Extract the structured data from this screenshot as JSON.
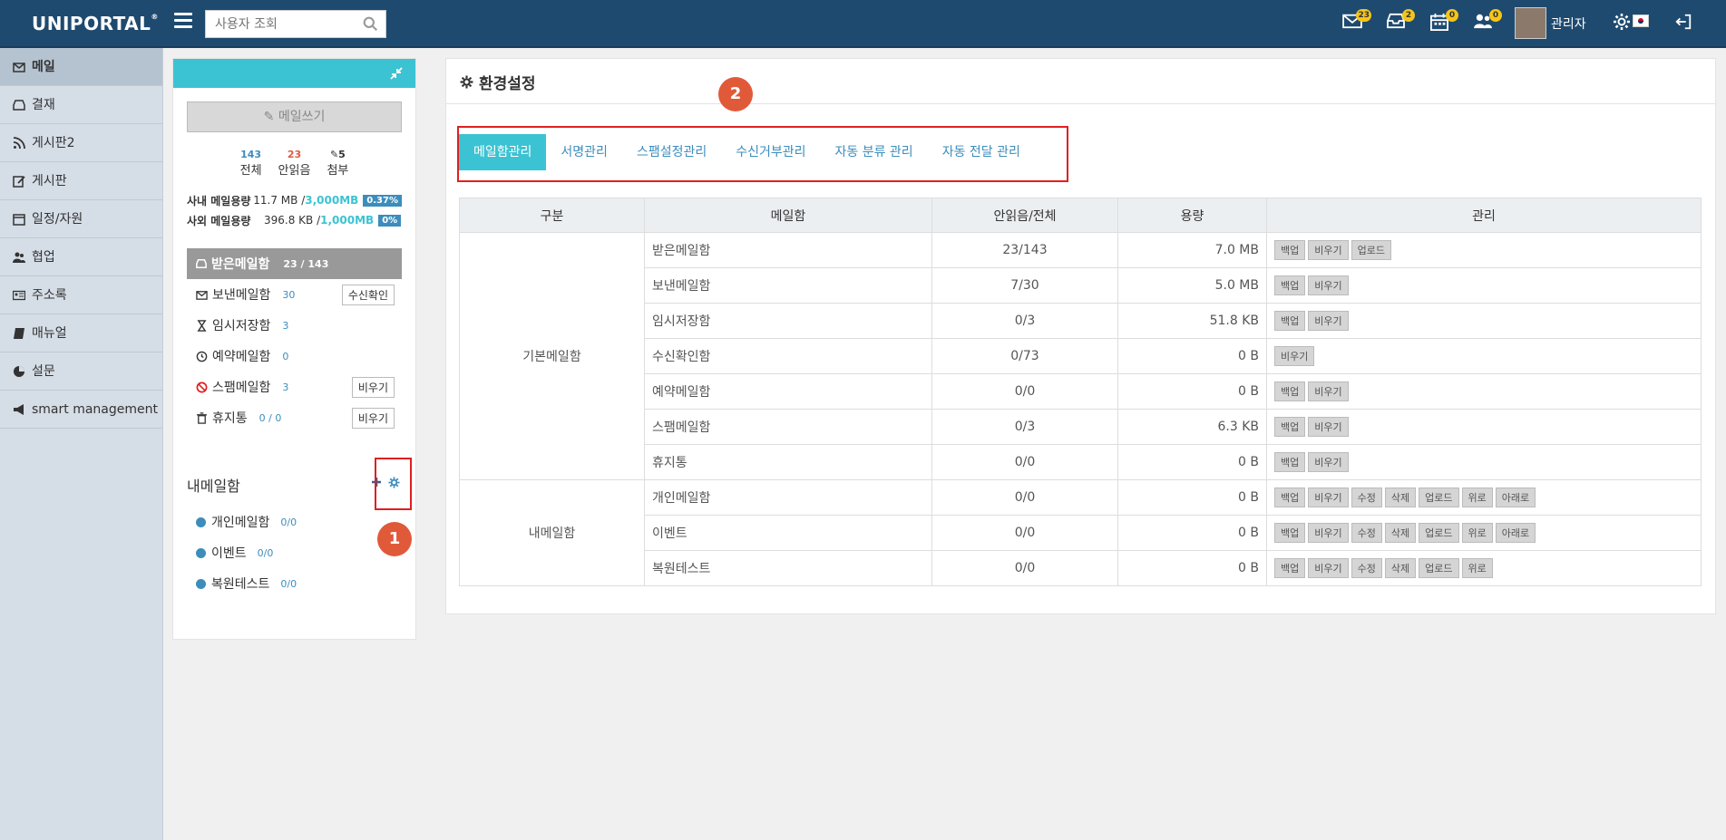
{
  "app": {
    "logo": "UNIPORTAL",
    "logo_mark": "®"
  },
  "header": {
    "search_placeholder": "사용자 조회",
    "badges": {
      "mail": "23",
      "inbox": "2",
      "calendar": "0",
      "people": "0"
    },
    "user_name": "관리자"
  },
  "leftnav": {
    "items": [
      {
        "label": "메일",
        "icon": "mail-icon"
      },
      {
        "label": "결재",
        "icon": "inbox-icon"
      },
      {
        "label": "게시판2",
        "icon": "rss-icon"
      },
      {
        "label": "게시판",
        "icon": "edit-icon"
      },
      {
        "label": "일정/자원",
        "icon": "calendar-icon"
      },
      {
        "label": "협업",
        "icon": "users-icon"
      },
      {
        "label": "주소록",
        "icon": "address-card-icon"
      },
      {
        "label": "매뉴얼",
        "icon": "book-icon"
      },
      {
        "label": "설문",
        "icon": "pie-chart-icon"
      },
      {
        "label": "smart management",
        "icon": "megaphone-icon"
      }
    ]
  },
  "mailpanel": {
    "write_label": "메일쓰기",
    "stats": [
      {
        "num": "143",
        "label": "전체"
      },
      {
        "num": "23",
        "label": "안읽음"
      },
      {
        "num": "5",
        "label": "첨부"
      }
    ],
    "quota": [
      {
        "label": "사내 메일용량",
        "used": "11.7 MB / ",
        "total": "3,000MB",
        "pct": "0.37%"
      },
      {
        "label": "사외 메일용량",
        "used": "396.8 KB / ",
        "total": "1,000MB",
        "pct": "0%"
      }
    ],
    "inbox": {
      "label": "받은메일함",
      "count": "23 / 143"
    },
    "folders": [
      {
        "label": "보낸메일함",
        "count": "30",
        "button": "수신확인"
      },
      {
        "label": "임시저장함",
        "count": "3",
        "button": ""
      },
      {
        "label": "예약메일함",
        "count": "0",
        "button": ""
      },
      {
        "label": "스팸메일함",
        "count": "3",
        "button": "비우기"
      },
      {
        "label": "휴지통",
        "count": "0 / 0",
        "button": "비우기"
      }
    ],
    "mybox_title": "내메일함",
    "mybox_items": [
      {
        "label": "개인메일함",
        "count": "0/0"
      },
      {
        "label": "이벤트",
        "count": "0/0"
      },
      {
        "label": "복원테스트",
        "count": "0/0"
      }
    ],
    "marker": "1"
  },
  "settings": {
    "title": "환경설정",
    "marker": "2",
    "tabs": [
      "메일함관리",
      "서명관리",
      "스팸설정관리",
      "수신거부관리",
      "자동 분류 관리",
      "자동 전달 관리"
    ],
    "table": {
      "headers": [
        "구분",
        "메일함",
        "안읽음/전체",
        "용량",
        "관리"
      ],
      "groups": [
        {
          "name": "기본메일함",
          "rows": [
            {
              "box": "받은메일함",
              "ratio": "23/143",
              "size": "7.0 MB",
              "actions": [
                "백업",
                "비우기",
                "업로드"
              ]
            },
            {
              "box": "보낸메일함",
              "ratio": "7/30",
              "size": "5.0 MB",
              "actions": [
                "백업",
                "비우기"
              ]
            },
            {
              "box": "임시저장함",
              "ratio": "0/3",
              "size": "51.8 KB",
              "actions": [
                "백업",
                "비우기"
              ]
            },
            {
              "box": "수신확인함",
              "ratio": "0/73",
              "size": "0 B",
              "actions": [
                "비우기"
              ]
            },
            {
              "box": "예약메일함",
              "ratio": "0/0",
              "size": "0 B",
              "actions": [
                "백업",
                "비우기"
              ]
            },
            {
              "box": "스팸메일함",
              "ratio": "0/3",
              "size": "6.3 KB",
              "actions": [
                "백업",
                "비우기"
              ]
            },
            {
              "box": "휴지통",
              "ratio": "0/0",
              "size": "0 B",
              "actions": [
                "백업",
                "비우기"
              ]
            }
          ]
        },
        {
          "name": "내메일함",
          "rows": [
            {
              "box": "개인메일함",
              "ratio": "0/0",
              "size": "0 B",
              "actions": [
                "백업",
                "비우기",
                "수정",
                "삭제",
                "업로드",
                "위로",
                "아래로"
              ]
            },
            {
              "box": "이벤트",
              "ratio": "0/0",
              "size": "0 B",
              "actions": [
                "백업",
                "비우기",
                "수정",
                "삭제",
                "업로드",
                "위로",
                "아래로"
              ]
            },
            {
              "box": "복원테스트",
              "ratio": "0/0",
              "size": "0 B",
              "actions": [
                "백업",
                "비우기",
                "수정",
                "삭제",
                "업로드",
                "위로"
              ]
            }
          ]
        }
      ]
    }
  }
}
